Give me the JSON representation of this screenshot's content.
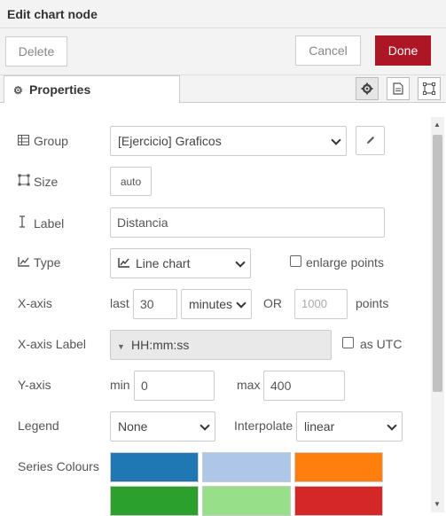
{
  "dialog": {
    "title": "Edit chart node"
  },
  "actions": {
    "delete_label": "Delete",
    "cancel_label": "Cancel",
    "done_label": "Done"
  },
  "tabs": {
    "properties_label": "Properties"
  },
  "form": {
    "group": {
      "label": "Group",
      "value": "[Ejercicio] Graficos"
    },
    "size": {
      "label": "Size",
      "value": "auto"
    },
    "label": {
      "label": "Label",
      "value": "Distancia"
    },
    "type": {
      "label": "Type",
      "value": "Line chart",
      "enlarge_label": "enlarge points"
    },
    "xaxis": {
      "label": "X-axis",
      "last_label": "last",
      "last_value": "30",
      "unit_value": "minutes",
      "or_label": "OR",
      "points_placeholder": "1000",
      "points_label": "points"
    },
    "xaxis_label": {
      "label": "X-axis Label",
      "value": "HH:mm:ss",
      "utc_label": "as UTC"
    },
    "yaxis": {
      "label": "Y-axis",
      "min_label": "min",
      "min_value": "0",
      "max_label": "max",
      "max_value": "400"
    },
    "legend": {
      "label": "Legend",
      "value": "None",
      "interpolate_label": "Interpolate",
      "interpolate_value": "linear"
    },
    "series_colours": {
      "label": "Series Colours",
      "colors": [
        "#1f77b4",
        "#aec7e8",
        "#ff7f0e",
        "#2ca02c",
        "#98df8a",
        "#d62728"
      ]
    }
  }
}
